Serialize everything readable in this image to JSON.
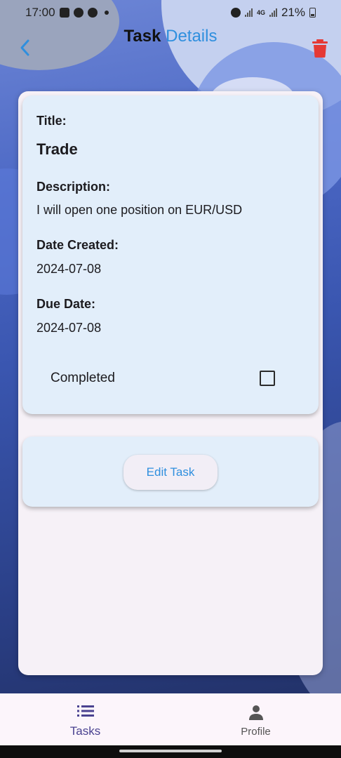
{
  "status_bar": {
    "time": "17:00",
    "network": "4G",
    "battery": "21%"
  },
  "header": {
    "title_part1": "Task",
    "title_part2": "Details",
    "back_icon": "chevron-left-icon",
    "delete_icon": "trash-icon"
  },
  "task": {
    "title_label": "Title:",
    "title_value": "Trade",
    "description_label": "Description:",
    "description_value": "I will open one position on EUR/USD",
    "date_created_label": "Date Created:",
    "date_created_value": "2024-07-08",
    "due_date_label": "Due Date:",
    "due_date_value": "2024-07-08",
    "completed_label": "Completed",
    "completed": false
  },
  "actions": {
    "edit_label": "Edit Task"
  },
  "bottom_nav": {
    "items": [
      {
        "label": "Tasks",
        "icon": "list-icon"
      },
      {
        "label": "Profile",
        "icon": "person-icon"
      }
    ]
  },
  "colors": {
    "accent": "#2f8fde",
    "delete": "#e53935",
    "card": "#e2eefa",
    "nav_active": "#4a4290"
  }
}
